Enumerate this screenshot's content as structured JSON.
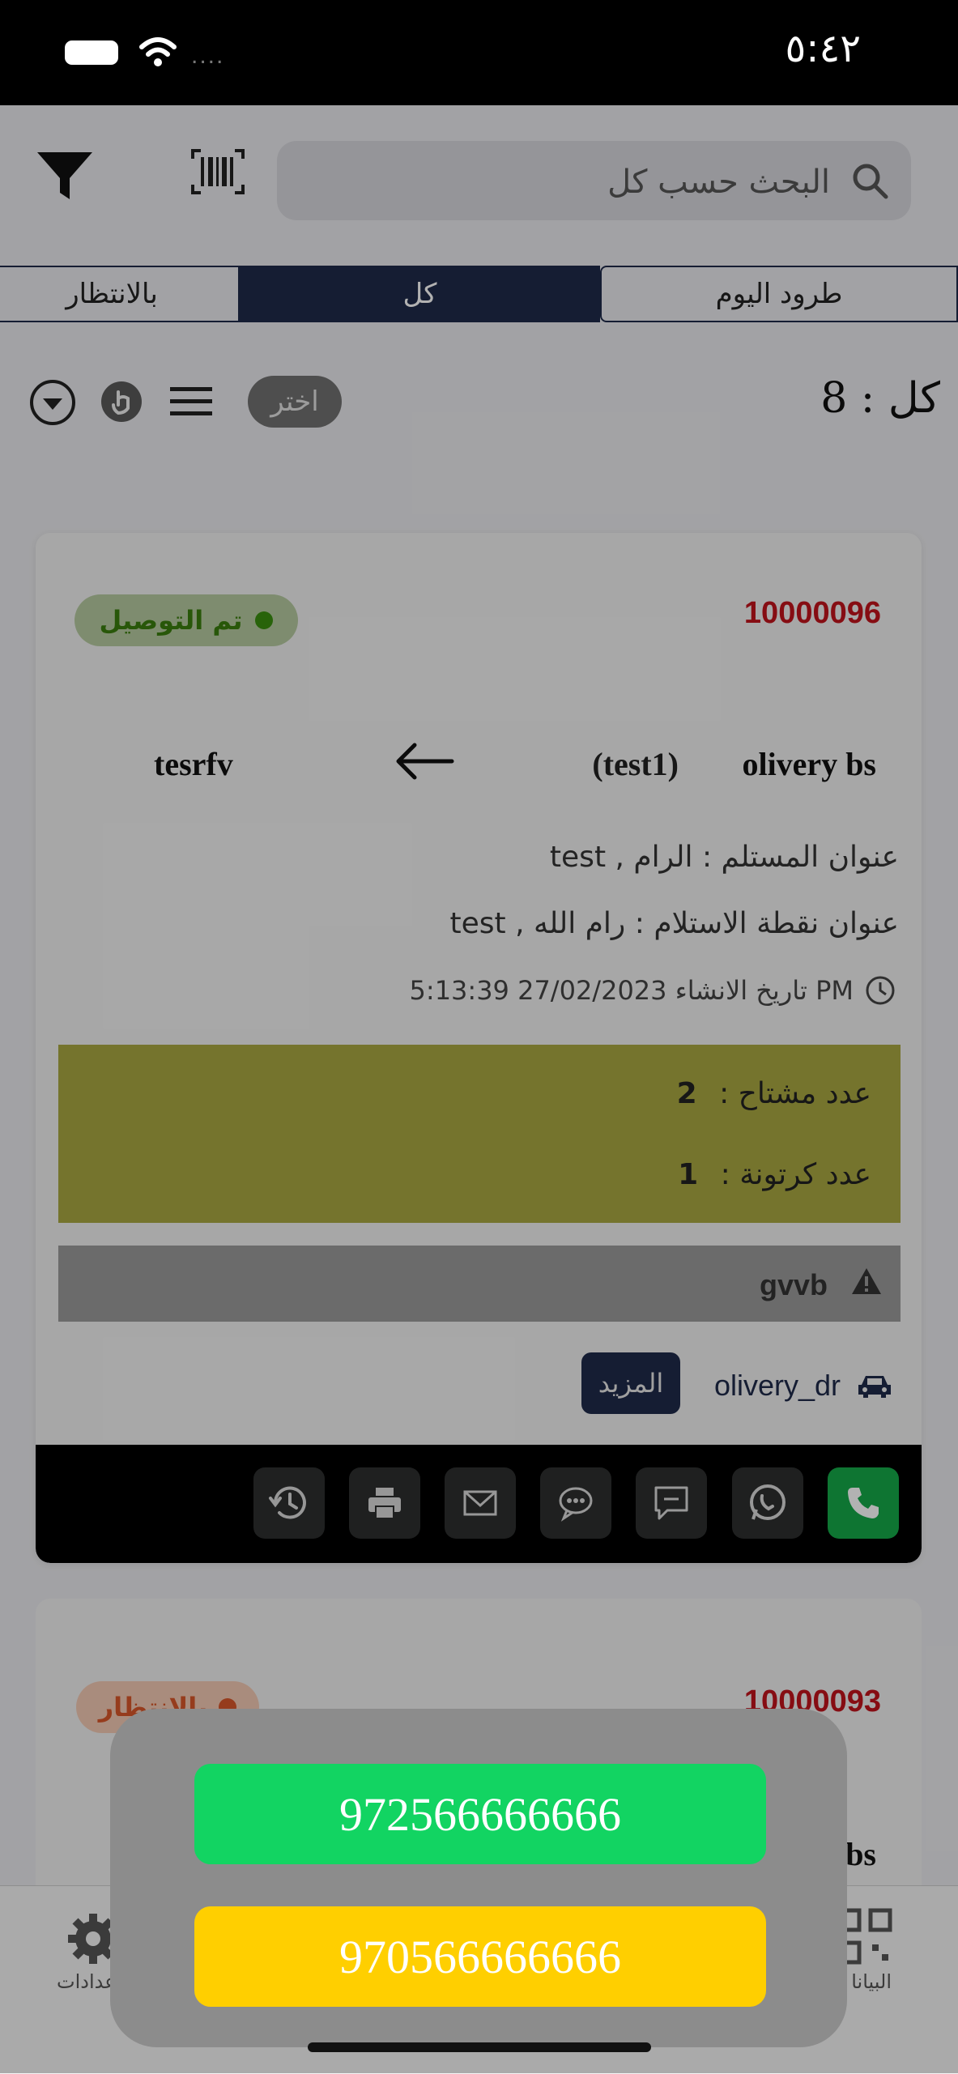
{
  "status_bar": {
    "time": "٥:٤٢",
    "signal_dots": "...."
  },
  "header": {
    "search_placeholder": "البحث حسب كل"
  },
  "tabs": [
    {
      "label": "طرود اليوم"
    },
    {
      "label": "كل",
      "selected": true
    },
    {
      "label": "بالانتظار"
    }
  ],
  "toolbar": {
    "count_label": "كل : 8",
    "select_label": "اختر"
  },
  "orders": [
    {
      "id": "10000096",
      "status": "تم التوصيل",
      "status_color": "#3a8e0f",
      "sender": "olivery bs",
      "sender_sub": "(test1)",
      "receiver": "tesrfv",
      "receiver_address": "عنوان المستلم : الرام , test",
      "pickup_address": "عنوان نقطة الاستلام : رام الله , test",
      "created_at": "تاريخ الانشاء 27/02/2023 5:13:39 PM",
      "pallets_label": "عدد مشتاح :",
      "pallets_value": "2",
      "cartons_label": "عدد كرتونة :",
      "cartons_value": "1",
      "note": "gvvb",
      "driver": "olivery_dr",
      "more_label": "المزيد"
    },
    {
      "id": "10000093",
      "status": "بالانتظار",
      "status_color": "#d7562a",
      "sender": "bs"
    }
  ],
  "bottom_nav": {
    "settings_label": "عدادات",
    "data_label": "البيانا"
  },
  "phone_popup": {
    "numbers": [
      "972566666666",
      "970566666666"
    ]
  },
  "colors": {
    "accent": "#1f2a4a",
    "call_green": "#15a848",
    "order_id_red": "#c0141c"
  }
}
